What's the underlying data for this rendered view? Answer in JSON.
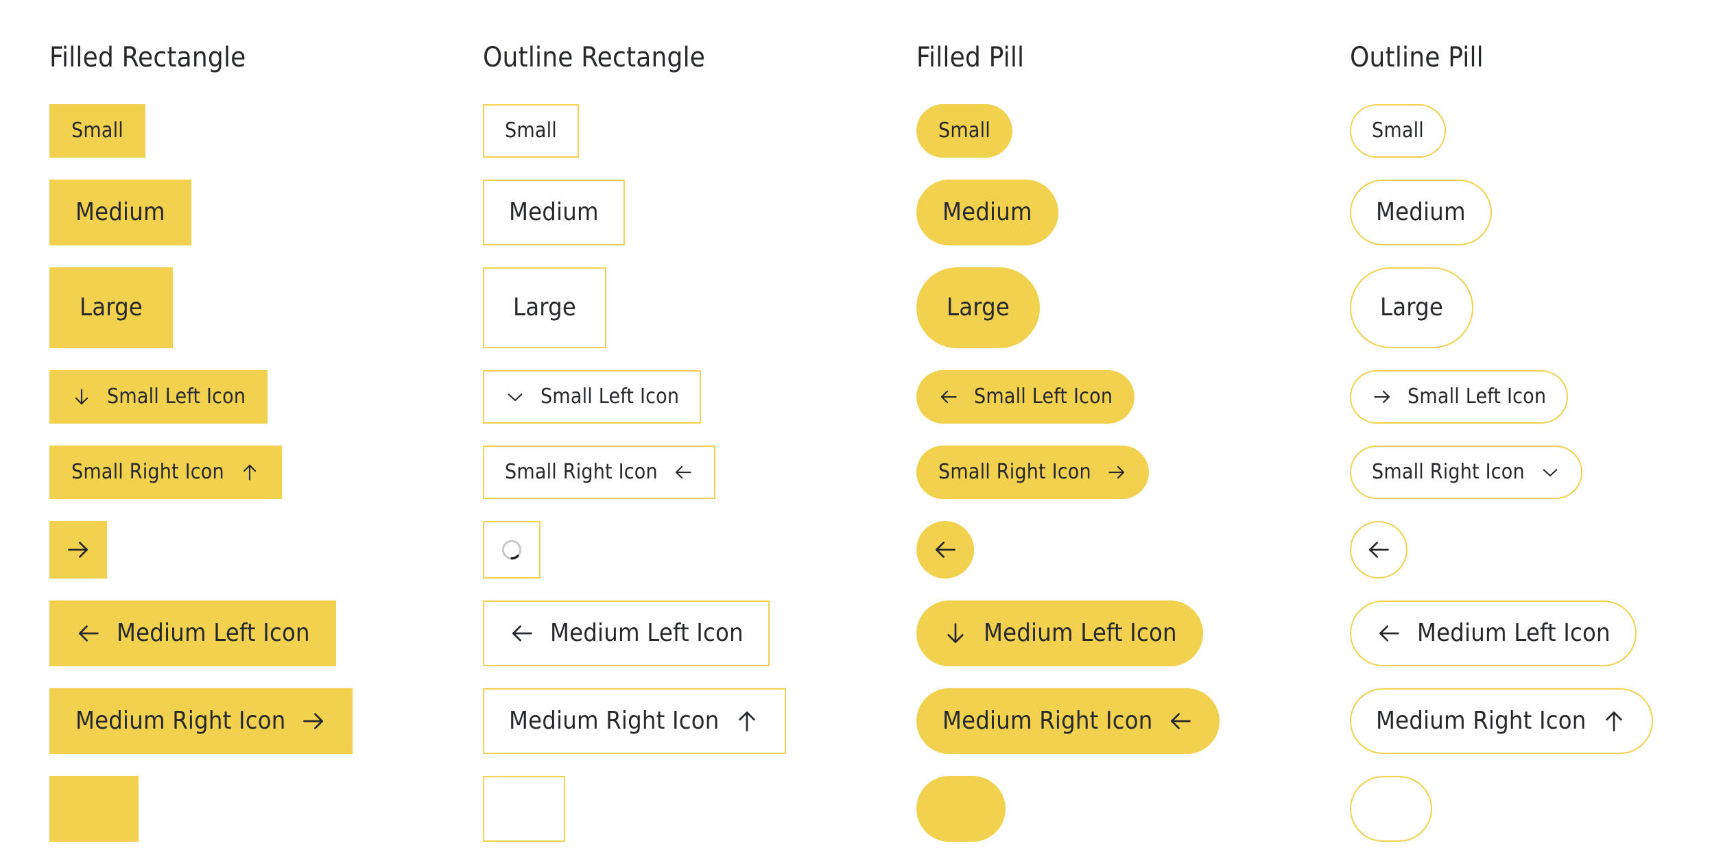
{
  "palette": {
    "accent": "#f2d14e",
    "text": "#26282b",
    "background": "#ffffff",
    "spinner_track": "#c9c9c9",
    "spinner_head": "#1a1a1a"
  },
  "columns": [
    {
      "heading": "Filled Rectangle",
      "variant": "filled",
      "shape": "rect",
      "buttons": [
        {
          "label": "Small",
          "size": "small",
          "icon": null,
          "icon_side": null
        },
        {
          "label": "Medium",
          "size": "medium",
          "icon": null,
          "icon_side": null
        },
        {
          "label": "Large",
          "size": "large",
          "icon": null,
          "icon_side": null
        },
        {
          "label": "Small Left Icon",
          "size": "small",
          "icon": "arrow-down",
          "icon_side": "left"
        },
        {
          "label": "Small Right Icon",
          "size": "small",
          "icon": "arrow-up",
          "icon_side": "right"
        },
        {
          "label": "",
          "size": "icononly",
          "icon": "arrow-right",
          "icon_side": "only"
        },
        {
          "label": "Medium Left Icon",
          "size": "medium",
          "icon": "arrow-left",
          "icon_side": "left"
        },
        {
          "label": "Medium Right Icon",
          "size": "medium",
          "icon": "arrow-right",
          "icon_side": "right"
        },
        {
          "label": "",
          "size": "partial",
          "icon": null,
          "icon_side": null
        }
      ]
    },
    {
      "heading": "Outline Rectangle",
      "variant": "outline",
      "shape": "rect",
      "buttons": [
        {
          "label": "Small",
          "size": "small",
          "icon": null,
          "icon_side": null
        },
        {
          "label": "Medium",
          "size": "medium",
          "icon": null,
          "icon_side": null
        },
        {
          "label": "Large",
          "size": "large",
          "icon": null,
          "icon_side": null
        },
        {
          "label": "Small Left Icon",
          "size": "small",
          "icon": "chevron-down",
          "icon_side": "left"
        },
        {
          "label": "Small Right Icon",
          "size": "small",
          "icon": "arrow-left",
          "icon_side": "right"
        },
        {
          "label": "",
          "size": "icononly",
          "icon": "spinner",
          "icon_side": "only"
        },
        {
          "label": "Medium Left Icon",
          "size": "medium",
          "icon": "arrow-left",
          "icon_side": "left"
        },
        {
          "label": "Medium Right Icon",
          "size": "medium",
          "icon": "arrow-up",
          "icon_side": "right"
        },
        {
          "label": "",
          "size": "partial",
          "icon": null,
          "icon_side": null
        }
      ]
    },
    {
      "heading": "Filled Pill",
      "variant": "filled",
      "shape": "pill",
      "buttons": [
        {
          "label": "Small",
          "size": "small",
          "icon": null,
          "icon_side": null
        },
        {
          "label": "Medium",
          "size": "medium",
          "icon": null,
          "icon_side": null
        },
        {
          "label": "Large",
          "size": "large",
          "icon": null,
          "icon_side": null
        },
        {
          "label": "Small Left Icon",
          "size": "small",
          "icon": "arrow-left",
          "icon_side": "left"
        },
        {
          "label": "Small Right Icon",
          "size": "small",
          "icon": "arrow-right",
          "icon_side": "right"
        },
        {
          "label": "",
          "size": "icononly",
          "icon": "arrow-left",
          "icon_side": "only"
        },
        {
          "label": "Medium Left Icon",
          "size": "medium",
          "icon": "arrow-down",
          "icon_side": "left"
        },
        {
          "label": "Medium Right Icon",
          "size": "medium",
          "icon": "arrow-left",
          "icon_side": "right"
        },
        {
          "label": "",
          "size": "partial",
          "icon": null,
          "icon_side": null
        }
      ]
    },
    {
      "heading": "Outline Pill",
      "variant": "outline",
      "shape": "pill",
      "buttons": [
        {
          "label": "Small",
          "size": "small",
          "icon": null,
          "icon_side": null
        },
        {
          "label": "Medium",
          "size": "medium",
          "icon": null,
          "icon_side": null
        },
        {
          "label": "Large",
          "size": "large",
          "icon": null,
          "icon_side": null
        },
        {
          "label": "Small Left Icon",
          "size": "small",
          "icon": "arrow-right",
          "icon_side": "left"
        },
        {
          "label": "Small Right Icon",
          "size": "small",
          "icon": "chevron-down",
          "icon_side": "right"
        },
        {
          "label": "",
          "size": "icononly",
          "icon": "arrow-left",
          "icon_side": "only"
        },
        {
          "label": "Medium Left Icon",
          "size": "medium",
          "icon": "arrow-left",
          "icon_side": "left"
        },
        {
          "label": "Medium Right Icon",
          "size": "medium",
          "icon": "arrow-up",
          "icon_side": "right"
        },
        {
          "label": "",
          "size": "partial",
          "icon": null,
          "icon_side": null
        }
      ]
    }
  ]
}
